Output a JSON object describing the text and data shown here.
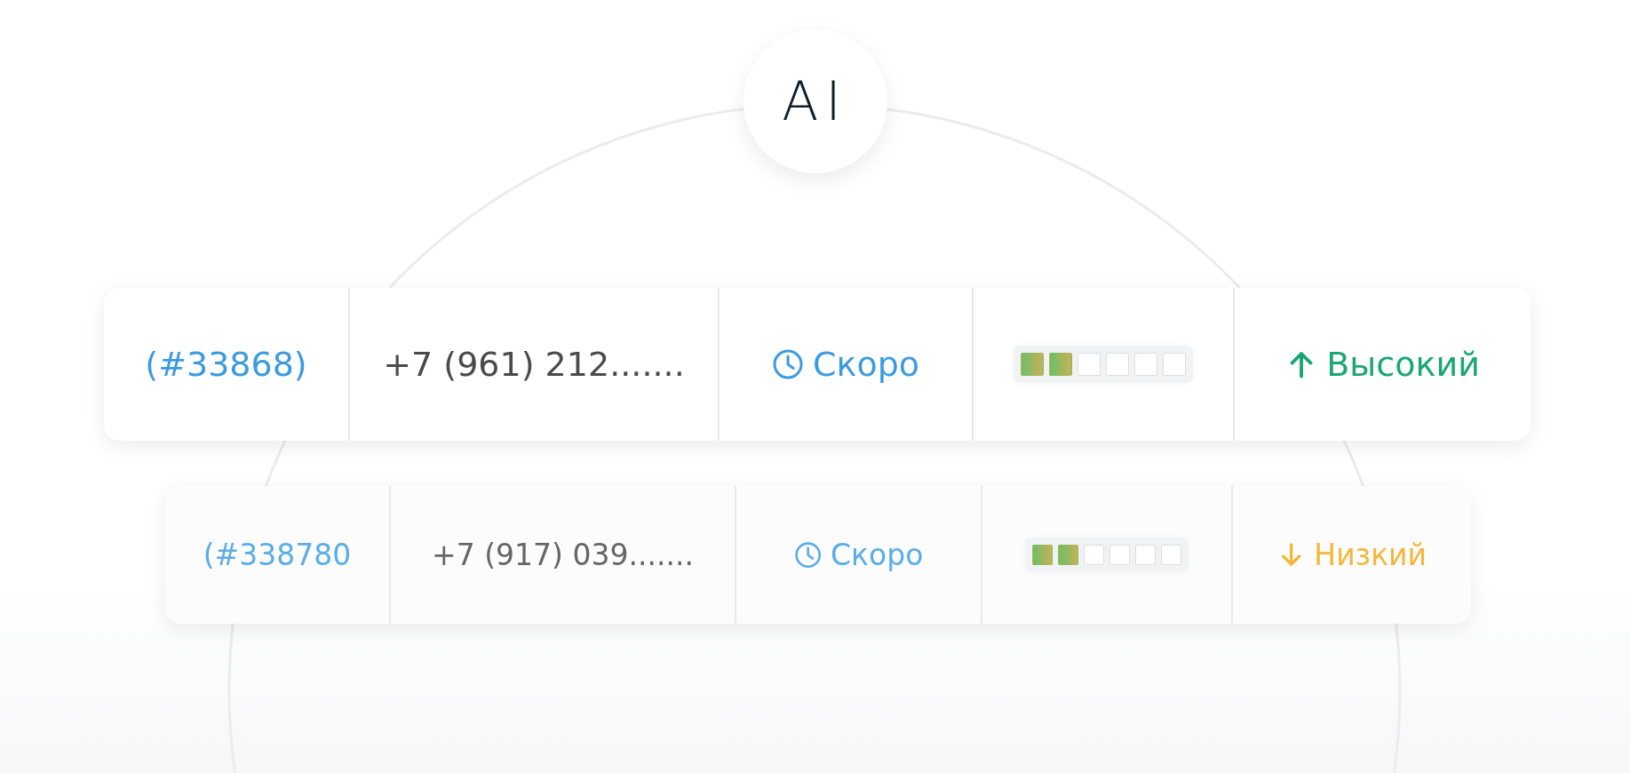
{
  "badge": {
    "text": "AI"
  },
  "rows": [
    {
      "id": "(#33868)",
      "phone": "+7 (961) 212.......",
      "status": "Скоро",
      "stars": 2,
      "priority": {
        "label": "Высокий",
        "kind": "up",
        "color": "#19a774"
      }
    },
    {
      "id": "(#338780",
      "phone": "+7 (917) 039.......",
      "status": "Скоро",
      "stars": 2,
      "priority": {
        "label": "Низкий",
        "kind": "down",
        "color": "#f4b73a"
      }
    }
  ]
}
